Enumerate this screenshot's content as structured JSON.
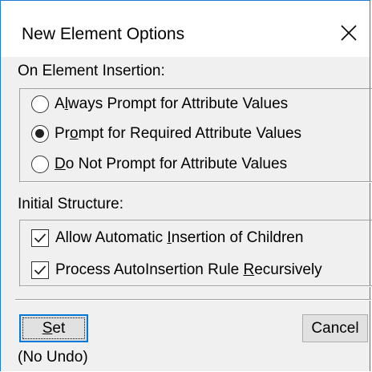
{
  "dialog": {
    "title": "New Element Options",
    "close_icon": "close-icon"
  },
  "insertion": {
    "label": "On Element Insertion:",
    "options": [
      {
        "pre": "A",
        "accel": "l",
        "post": "ways Prompt for Attribute Values",
        "checked": false
      },
      {
        "pre": "Pr",
        "accel": "o",
        "post": "mpt for Required Attribute Values",
        "checked": true
      },
      {
        "pre": "",
        "accel": "D",
        "post": "o Not Prompt for Attribute Values",
        "checked": false
      }
    ]
  },
  "structure": {
    "label": "Initial Structure:",
    "checks": [
      {
        "pre": "Allow Automatic ",
        "accel": "I",
        "post": "nsertion of Children",
        "checked": true
      },
      {
        "pre": "Process AutoInsertion Rule ",
        "accel": "R",
        "post": "ecursively",
        "checked": true
      }
    ]
  },
  "buttons": {
    "set_accel": "S",
    "set_rest": "et",
    "cancel": "Cancel"
  },
  "status": "(No Undo)"
}
